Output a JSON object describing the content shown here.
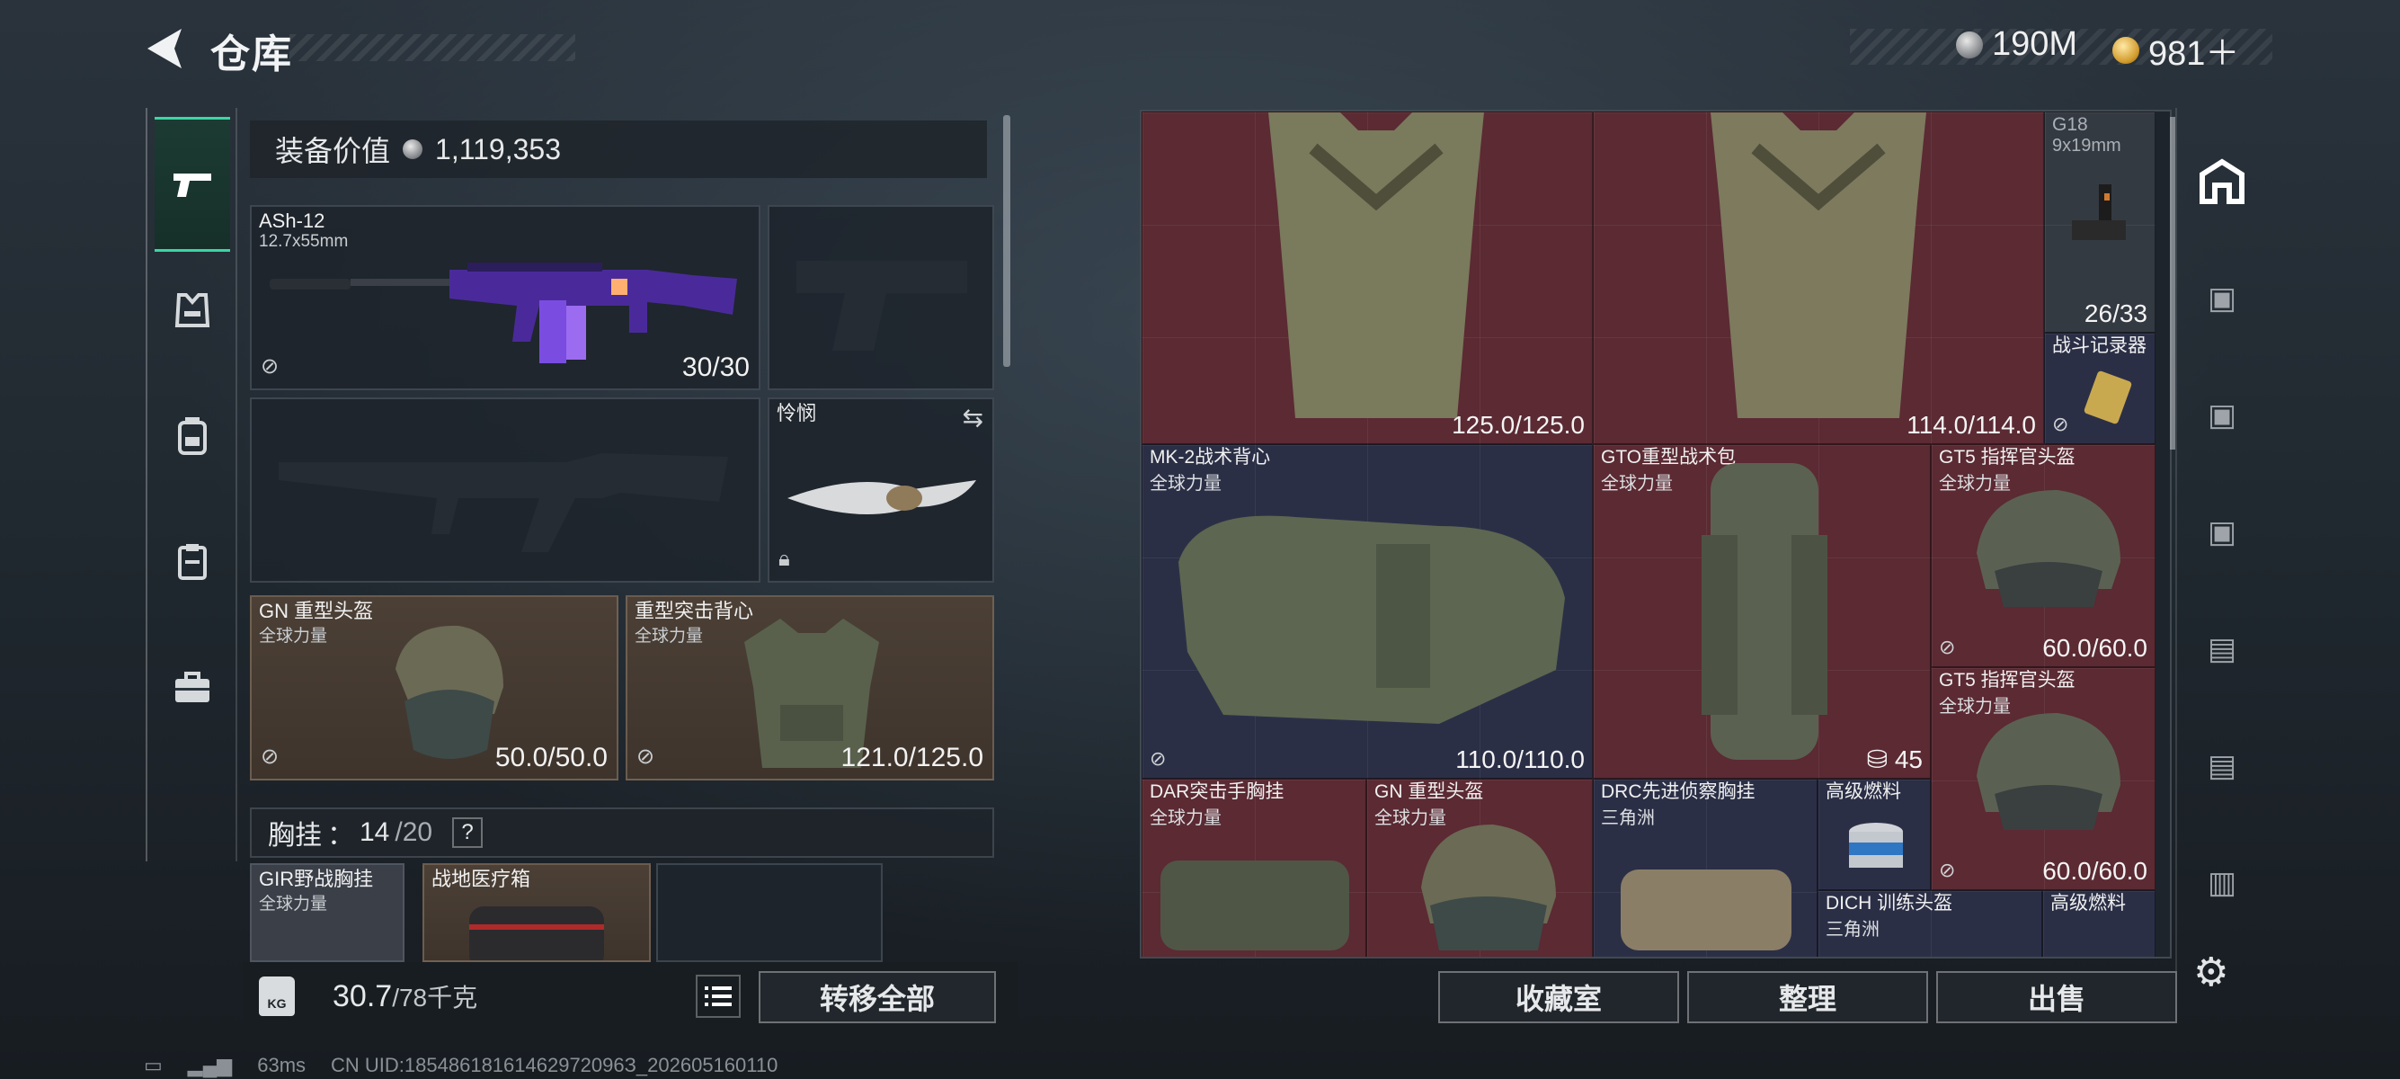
{
  "header": {
    "title": "仓库",
    "currency_silver": "190M",
    "currency_gold": "981＋"
  },
  "left_nav": {
    "items": [
      {
        "name": "firearms",
        "icon": "pistol-icon"
      },
      {
        "name": "armor",
        "icon": "vest-icon"
      },
      {
        "name": "backpack",
        "icon": "backpack-icon"
      },
      {
        "name": "chest-rig",
        "icon": "rig-icon"
      },
      {
        "name": "case",
        "icon": "briefcase-icon"
      }
    ]
  },
  "equipment": {
    "value_label": "装备价值",
    "value": "1,119,353",
    "primary_weapon": {
      "name": "ASh-12",
      "caliber": "12.7x55mm",
      "ammo": "30/30"
    },
    "melee": {
      "name": "怜悯"
    },
    "helmet": {
      "name": "GN 重型头盔",
      "faction": "全球力量",
      "durability": "50.0/50.0"
    },
    "armor": {
      "name": "重型突击背心",
      "faction": "全球力量",
      "durability": "121.0/125.0"
    },
    "chest_rig": {
      "label": "胸挂",
      "sep": "：",
      "used": "14",
      "max": "/20",
      "help": "?"
    },
    "rig_items": [
      {
        "name": "GIR野战胸挂",
        "faction": "全球力量"
      },
      {
        "name": "战地医疗箱"
      }
    ],
    "weight": {
      "current": "30.7",
      "max": "/78千克"
    },
    "transfer_all": "转移全部"
  },
  "grid_items": [
    {
      "id": "armor-a",
      "durability": "125.0/125.0"
    },
    {
      "id": "armor-b",
      "durability": "114.0/114.0"
    },
    {
      "id": "g18",
      "name": "G18",
      "caliber": "9x19mm",
      "ammo": "26/33"
    },
    {
      "id": "recorder",
      "name": "战斗记录器"
    },
    {
      "id": "mk2",
      "name": "MK-2战术背心",
      "faction": "全球力量",
      "durability": "110.0/110.0"
    },
    {
      "id": "gto",
      "name": "GTO重型战术包",
      "faction": "全球力量",
      "count": "45"
    },
    {
      "id": "gt5-a",
      "name": "GT5 指挥官头盔",
      "faction": "全球力量",
      "durability": "60.0/60.0"
    },
    {
      "id": "gt5-b",
      "name": "GT5 指挥官头盔",
      "faction": "全球力量",
      "durability": "60.0/60.0"
    },
    {
      "id": "dar",
      "name": "DAR突击手胸挂",
      "faction": "全球力量"
    },
    {
      "id": "gn",
      "name": "GN 重型头盔",
      "faction": "全球力量"
    },
    {
      "id": "drc",
      "name": "DRC先进侦察胸挂",
      "faction": "三角洲"
    },
    {
      "id": "fuel-a",
      "name": "高级燃料"
    },
    {
      "id": "dich",
      "name": "DICH 训练头盔",
      "faction": "三角洲"
    },
    {
      "id": "fuel-b",
      "name": "高级燃料"
    }
  ],
  "right_buttons": {
    "collection": "收藏室",
    "organize": "整理",
    "sell": "出售"
  },
  "footer": {
    "ping": "63ms",
    "uid": "CN UID:18548618161462972096З_202605160110"
  }
}
